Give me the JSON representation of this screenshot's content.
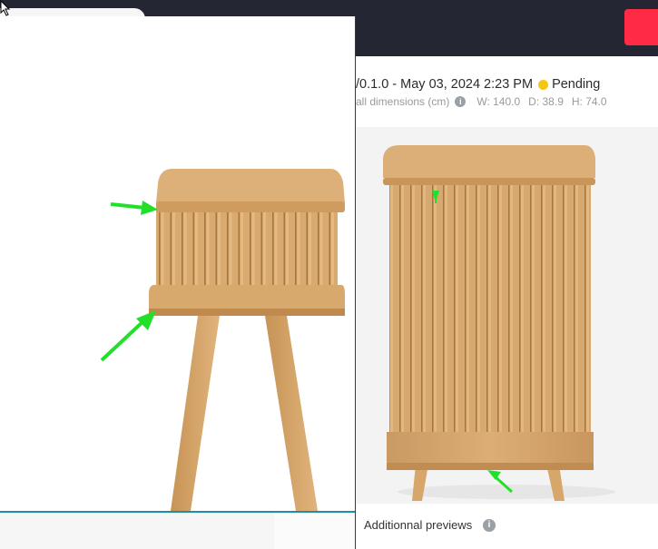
{
  "header": {
    "action_button_color": "#ff2a44"
  },
  "version": {
    "label": "/0.1.0 - May 03, 2024 2:23 PM",
    "status": "Pending",
    "status_color": "#f5c518"
  },
  "dimensions": {
    "label": "all dimensions (cm)",
    "width": "W: 140.0",
    "depth": "D: 38.9",
    "height": "H: 74.0"
  },
  "previews": {
    "label": "Additionnal previews"
  },
  "annotations": {
    "arrow_color": "#22e02a"
  },
  "icons": [
    "cursor-icon",
    "info-icon",
    "arrow-annotation-icon"
  ]
}
